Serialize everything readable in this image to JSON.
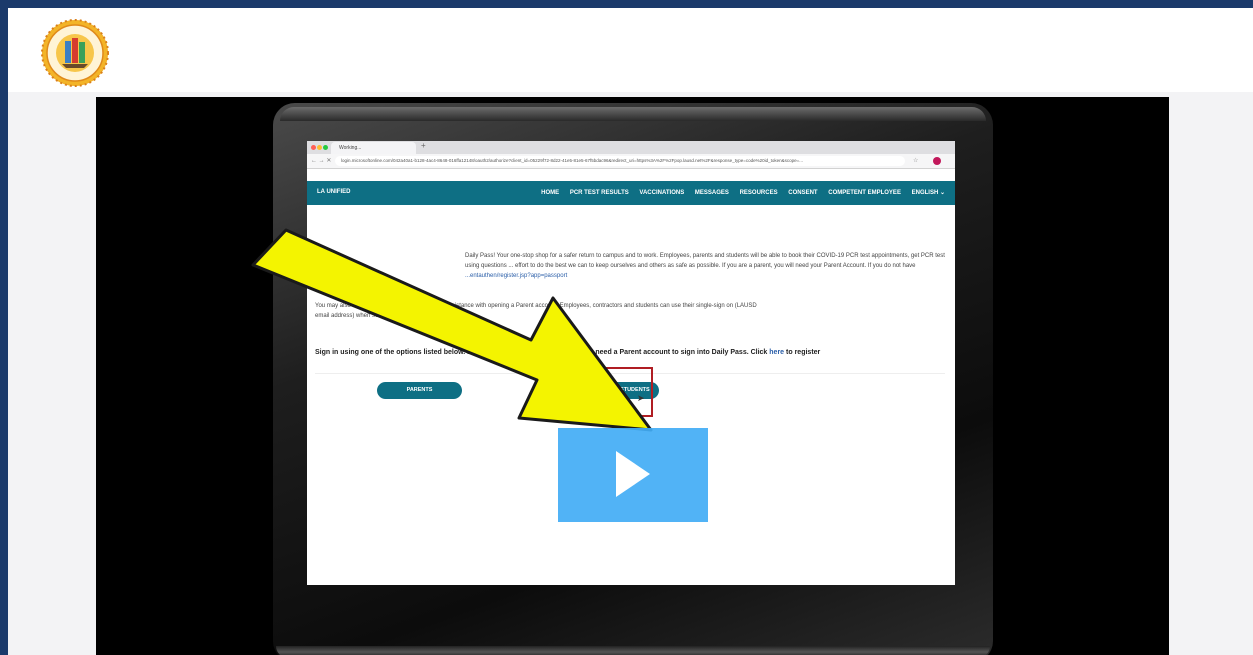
{
  "logo": {
    "alt_text_visible": "LOS ANGELES UNIFIED SCHOOL DISTRICT",
    "motto": "STUDENTS AT THE CENTER"
  },
  "video": {
    "browser": {
      "tab_title": "Working...",
      "url": "login.microsoftonline.com/042a40a1-b128-4ac4-8648-016ffa12148/oauth2/authorize?client_id=05229f72-8d22-41e5-81e5-67f5bdac96&redirect_uri=https%3A%2F%2Fpop.lausd.net%2F&response_type=code%20id_token&scope=..."
    },
    "site_nav": {
      "brand": "LA UNIFIED",
      "items": [
        "HOME",
        "PCR TEST RESULTS",
        "VACCINATIONS",
        "MESSAGES",
        "RESOURCES",
        "CONSENT",
        "COMPETENT EMPLOYEE",
        "ENGLISH ⌄"
      ]
    },
    "paragraph1_line1": "Daily Pass! Your one-stop shop for a safer return to campus and to work. Employees, parents and students will be able to book their COVID-19 PCR test appointments, get PCR test",
    "paragraph1_line2": "using questions ... effort to do the best we can to keep ourselves and others as safe as possible. If you are a parent, you will need your Parent Account. If you do not have",
    "paragraph1_link": "...entauthen/register.jsp?app=passport",
    "paragraph2_line1": "You may also contact ... line at 213-443-1300 for assistance with opening a Parent account. Employees, contractors and students can use their single-sign on (LAUSD",
    "paragraph2_line2": "email address) when selecting \"E...",
    "signin_text": "Sign in using one of the options listed below. Parents/ guardians, can't sign in? You need a Parent account to sign into Daily Pass. Click",
    "signin_link": "here",
    "signin_suffix": "to register",
    "buttons": {
      "parents": "PARENTS",
      "employees_students": "EMPLOYEES/STUDENTS"
    }
  },
  "colors": {
    "page_border": "#1b3a6b",
    "nav_teal": "#0e6f84",
    "play_blue": "#42adf5",
    "arrow_yellow": "#f4f400",
    "highlight_red": "#b01d23"
  }
}
